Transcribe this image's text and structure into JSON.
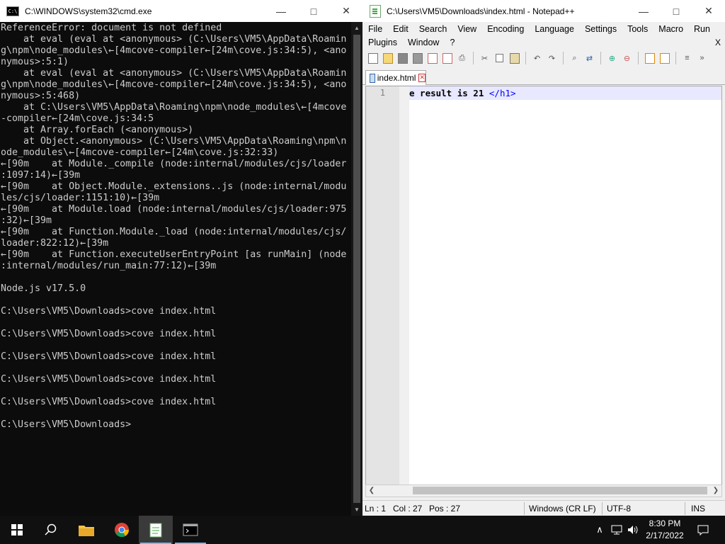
{
  "cmd": {
    "title": "C:\\WINDOWS\\system32\\cmd.exe",
    "icon_text": "C:\\",
    "output": "ReferenceError: document is not defined\n    at eval (eval at <anonymous> (C:\\Users\\VM5\\AppData\\Roamin\ng\\npm\\node_modules\\←[4mcove-compiler←[24m\\cove.js:34:5), <ano\nnymous>:5:1)\n    at eval (eval at <anonymous> (C:\\Users\\VM5\\AppData\\Roamin\ng\\npm\\node_modules\\←[4mcove-compiler←[24m\\cove.js:34:5), <ano\nnymous>:5:468)\n    at C:\\Users\\VM5\\AppData\\Roaming\\npm\\node_modules\\←[4mcove\n-compiler←[24m\\cove.js:34:5\n    at Array.forEach (<anonymous>)\n    at Object.<anonymous> (C:\\Users\\VM5\\AppData\\Roaming\\npm\\n\node_modules\\←[4mcove-compiler←[24m\\cove.js:32:33)\n←[90m    at Module._compile (node:internal/modules/cjs/loader\n:1097:14)←[39m\n←[90m    at Object.Module._extensions..js (node:internal/modu\nles/cjs/loader:1151:10)←[39m\n←[90m    at Module.load (node:internal/modules/cjs/loader:975\n:32)←[39m\n←[90m    at Function.Module._load (node:internal/modules/cjs/\nloader:822:12)←[39m\n←[90m    at Function.executeUserEntryPoint [as runMain] (node\n:internal/modules/run_main:77:12)←[39m\n\nNode.js v17.5.0\n\nC:\\Users\\VM5\\Downloads>cove index.html\n\nC:\\Users\\VM5\\Downloads>cove index.html\n\nC:\\Users\\VM5\\Downloads>cove index.html\n\nC:\\Users\\VM5\\Downloads>cove index.html\n\nC:\\Users\\VM5\\Downloads>cove index.html\n\nC:\\Users\\VM5\\Downloads>"
  },
  "npp": {
    "title": "C:\\Users\\VM5\\Downloads\\index.html - Notepad++",
    "menu_row1": [
      "File",
      "Edit",
      "Search",
      "View",
      "Encoding",
      "Language",
      "Settings",
      "Tools",
      "Macro",
      "Run"
    ],
    "menu_row2": [
      "Plugins",
      "Window",
      "?"
    ],
    "menu_close": "X",
    "tab_label": "index.html",
    "line_number": "1",
    "code_text": "e result is 21 ",
    "code_tag": "</h1>",
    "status": {
      "ln": "Ln : 1",
      "col": "Col : 27",
      "pos": "Pos : 27",
      "eol": "Windows (CR LF)",
      "encoding": "UTF-8",
      "mode": "INS"
    }
  },
  "taskbar": {
    "time": "8:30 PM",
    "date": "2/17/2022"
  }
}
